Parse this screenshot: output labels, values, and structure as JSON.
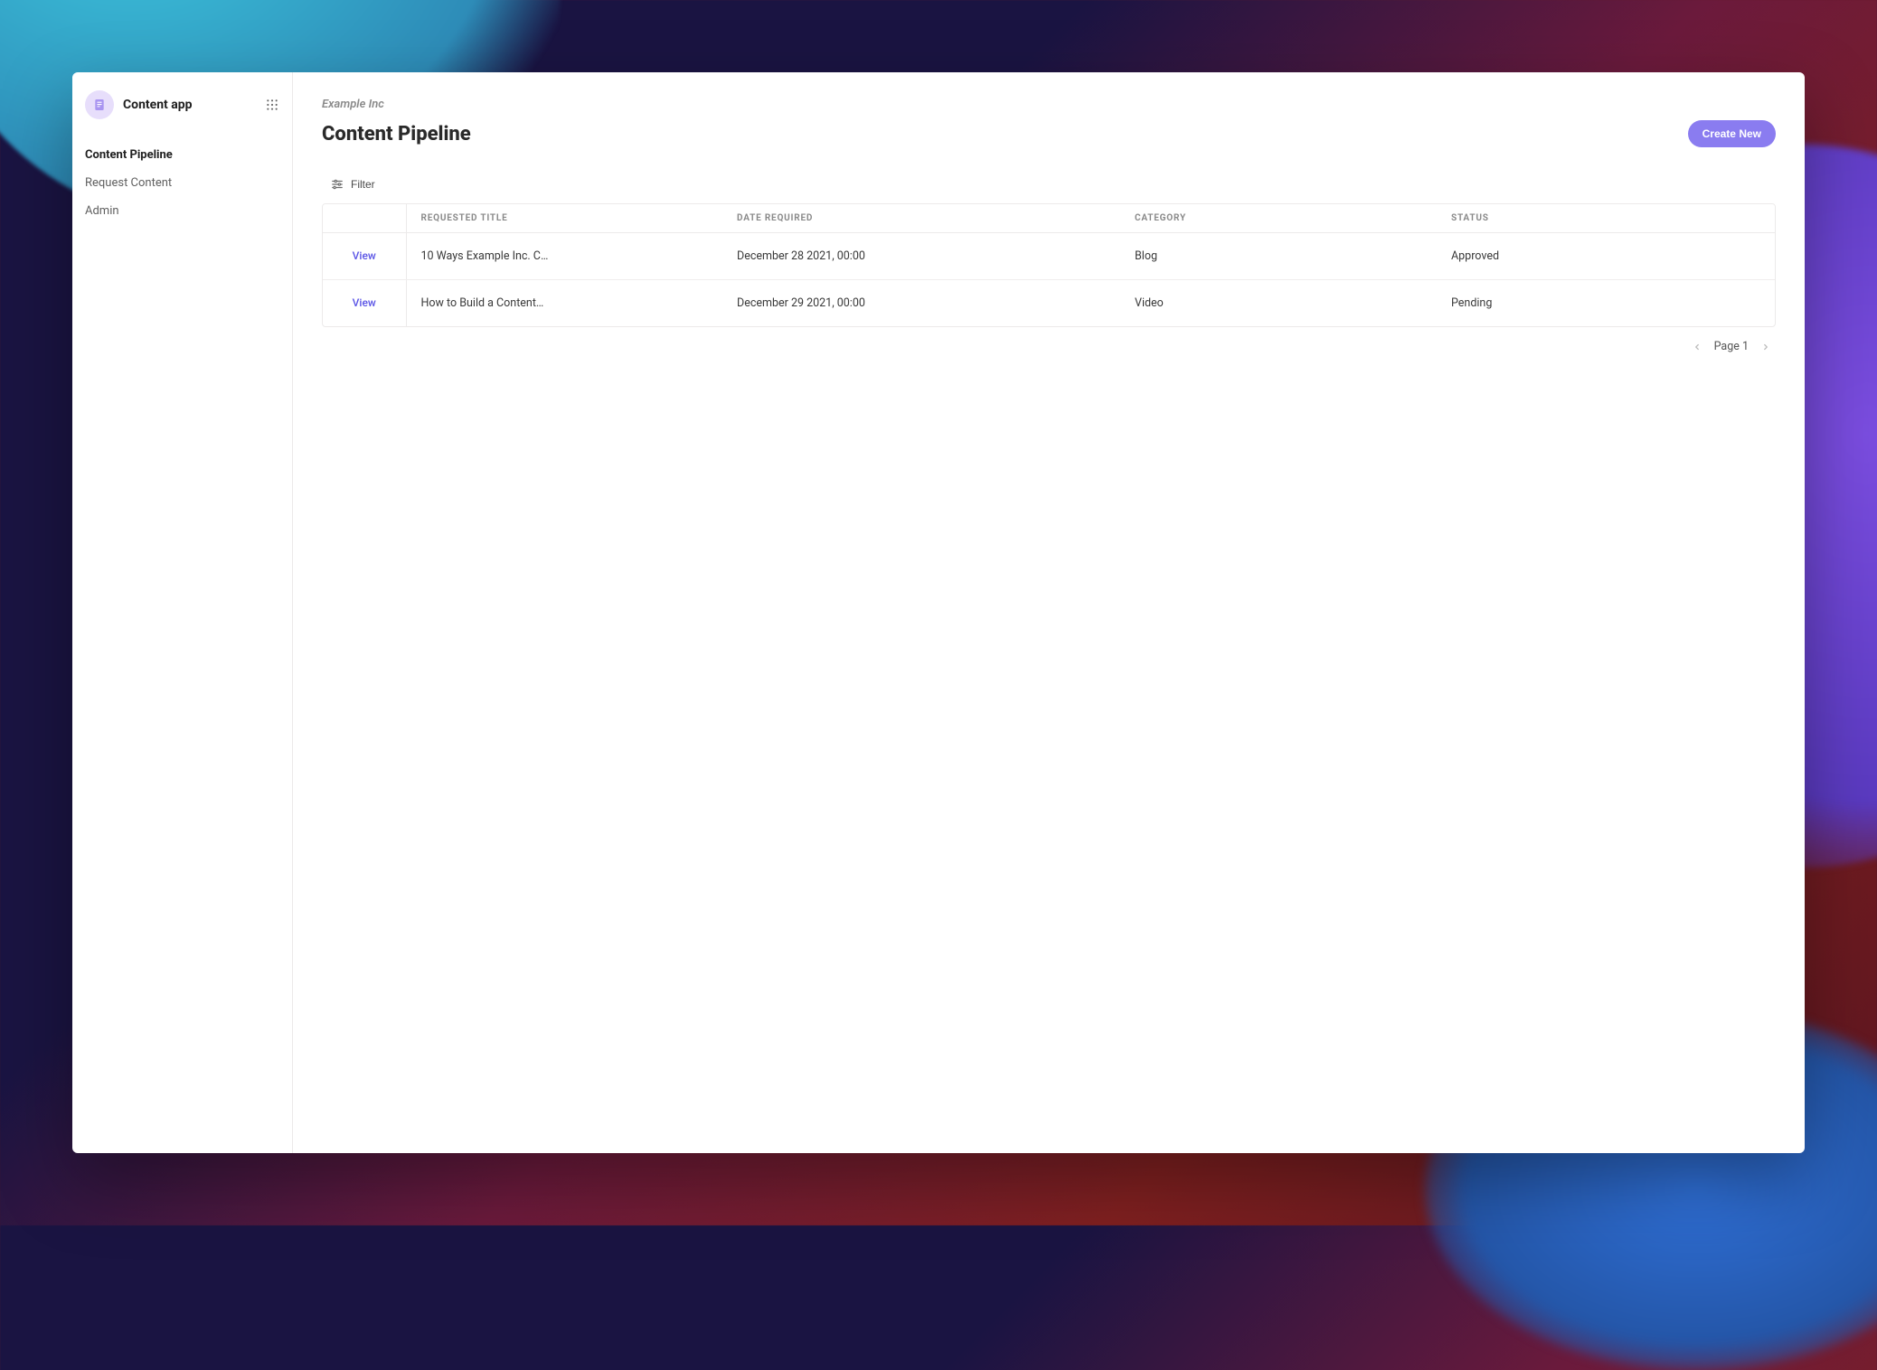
{
  "app": {
    "name": "Content app"
  },
  "sidebar": {
    "items": [
      {
        "label": "Content Pipeline",
        "active": true
      },
      {
        "label": "Request Content",
        "active": false
      },
      {
        "label": "Admin",
        "active": false
      }
    ]
  },
  "header": {
    "org": "Example Inc",
    "title": "Content Pipeline",
    "create_label": "Create New"
  },
  "toolbar": {
    "filter_label": "Filter"
  },
  "table": {
    "columns": {
      "action": "",
      "title": "REQUESTED TITLE",
      "date": "DATE REQUIRED",
      "category": "CATEGORY",
      "status": "STATUS"
    },
    "view_label": "View",
    "rows": [
      {
        "title": "10 Ways Example Inc. C…",
        "date": "December 28 2021, 00:00",
        "category": "Blog",
        "status": "Approved"
      },
      {
        "title": "How to Build a Content…",
        "date": "December 29 2021, 00:00",
        "category": "Video",
        "status": "Pending"
      }
    ]
  },
  "pagination": {
    "label": "Page 1"
  },
  "colors": {
    "accent": "#8a7cf0",
    "link": "#5b55e6"
  }
}
